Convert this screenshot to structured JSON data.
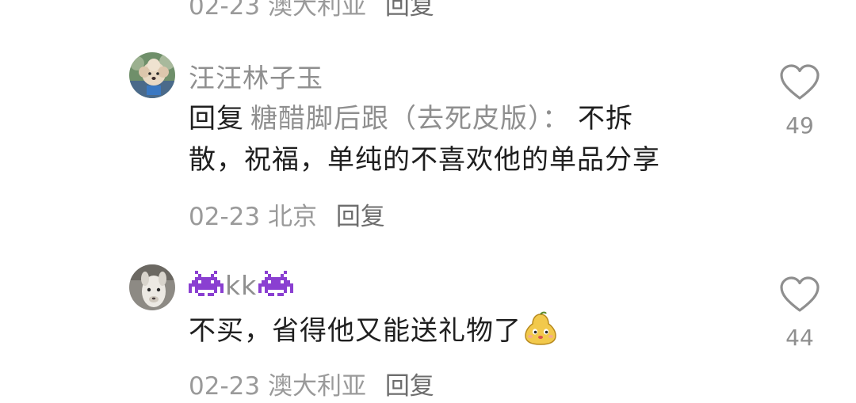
{
  "previous_comment": {
    "date": "02-23",
    "location": "澳大利亚",
    "reply_label": "回复"
  },
  "comments": [
    {
      "username": "汪汪林子玉",
      "reply_prefix": "回复",
      "reply_to": "糖醋脚后跟（去死皮版）：",
      "text_line1": "不拆",
      "text_line2": "散，祝福，单纯的不喜欢他的单品分享",
      "date": "02-23",
      "location": "北京",
      "reply_label": "回复",
      "like_count": "49",
      "avatar": "poodle-dog-avatar"
    },
    {
      "username": "kk",
      "username_decorations": "space-invader-emoji",
      "text": "不买，省得他又能送礼物了",
      "text_emoji": "pear-face-emoji",
      "date": "02-23",
      "location": "澳大利亚",
      "reply_label": "回复",
      "like_count": "44",
      "avatar": "alpaca-avatar"
    }
  ],
  "icons": {
    "like": "heart-outline-icon"
  },
  "colors": {
    "text": "#1f1f1f",
    "muted": "#8f8f8f",
    "meta": "#9a9a9a",
    "invader": "#8a3fd1"
  }
}
